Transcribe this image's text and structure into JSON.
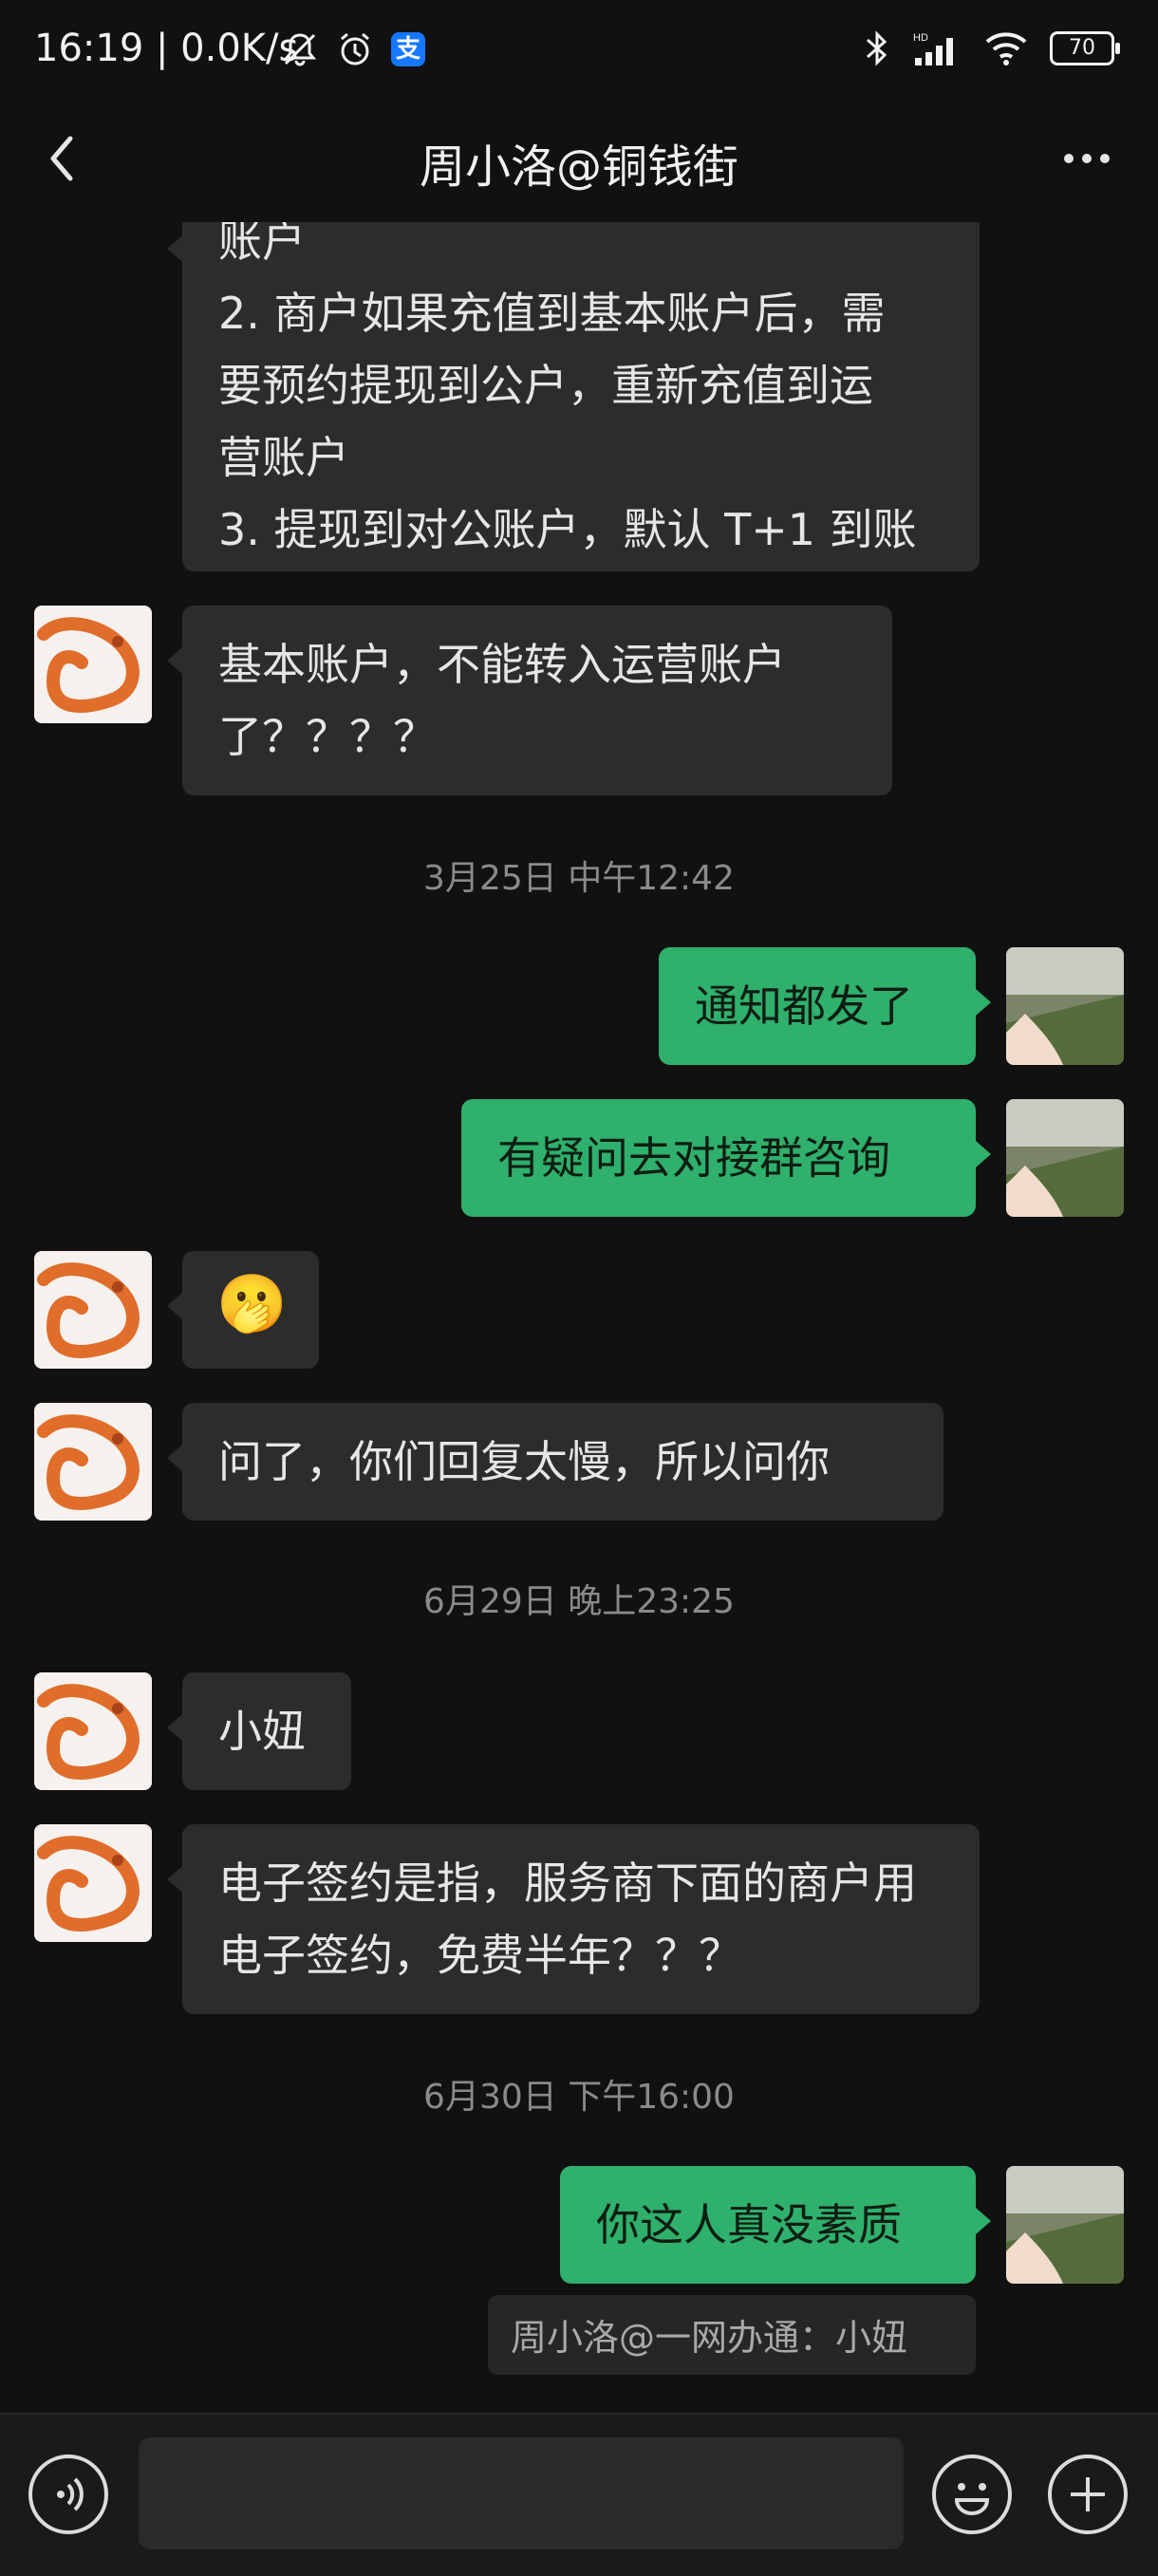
{
  "status_bar": {
    "time_speed": "16:19 | 0.0K/s",
    "alipay_glyph": "支",
    "battery": "70"
  },
  "header": {
    "title": "周小洛@铜钱街"
  },
  "messages": [
    {
      "side": "in",
      "text_lines": [
        "账户",
        "2. 商户如果充值到基本账户后，需",
        "要预约提现到公户，重新充值到运",
        "营账户",
        "3. 提现到对公账户，默认 T+1 到账"
      ]
    },
    {
      "side": "in",
      "text": "基本账户，不能转入运营账户了？？？？"
    },
    {
      "timestamp": "3月25日 中午12:42"
    },
    {
      "side": "out",
      "text": "通知都发了"
    },
    {
      "side": "out",
      "text": "有疑问去对接群咨询"
    },
    {
      "side": "in",
      "emoji": "🫢"
    },
    {
      "side": "in",
      "text": "问了，你们回复太慢，所以问你"
    },
    {
      "timestamp": "6月29日 晚上23:25"
    },
    {
      "side": "in",
      "text": "小妞"
    },
    {
      "side": "in",
      "text": "电子签约是指，服务商下面的商户用电子签约，免费半年？？？"
    },
    {
      "timestamp": "6月30日 下午16:00"
    },
    {
      "side": "out",
      "text": "你这人真没素质"
    },
    {
      "quote": "周小洛@一网办通：小妞"
    }
  ],
  "colors": {
    "outgoing_bubble": "#2fb06c",
    "incoming_bubble": "#2c2c2c",
    "background": "#111111"
  },
  "icons": [
    "back-arrow-icon",
    "more-dots-icon",
    "voice-icon",
    "emoji-icon",
    "plus-icon",
    "bluetooth-icon",
    "signal-icon",
    "wifi-icon",
    "alarm-icon",
    "mute-bell-icon"
  ]
}
